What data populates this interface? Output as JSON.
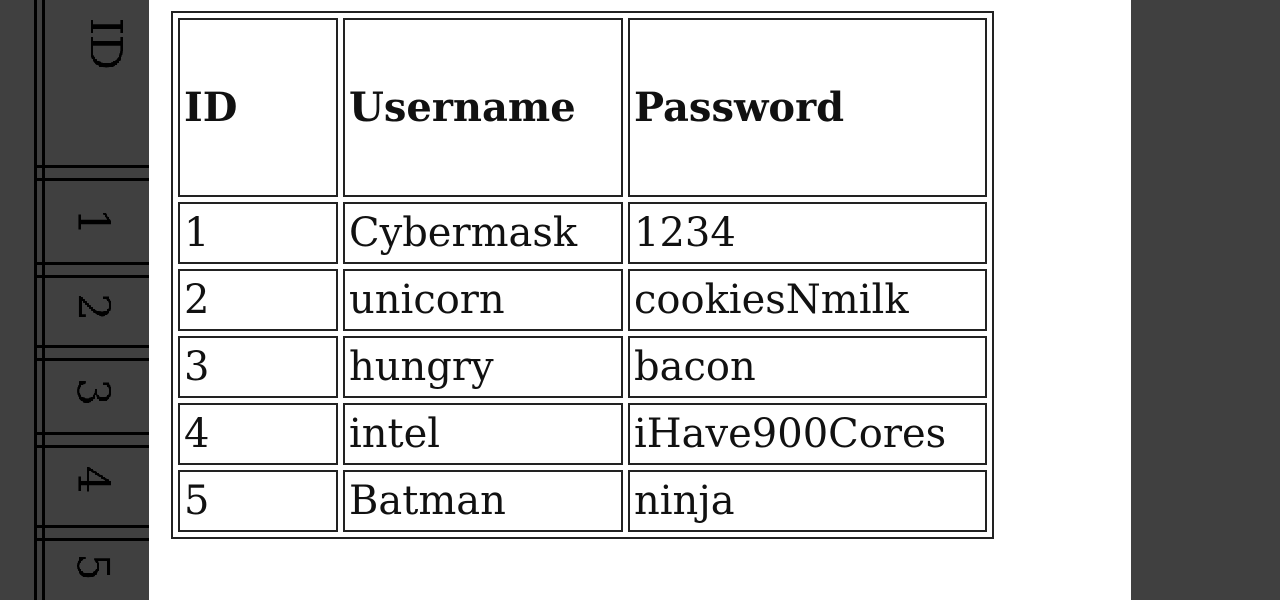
{
  "table": {
    "headers": [
      "ID",
      "Username",
      "Password"
    ],
    "rows": [
      [
        "1",
        "Cybermask",
        "1234"
      ],
      [
        "2",
        "unicorn",
        "cookiesNmilk"
      ],
      [
        "3",
        "hungry",
        "bacon"
      ],
      [
        "4",
        "intel",
        "iHave900Cores"
      ],
      [
        "5",
        "Batman",
        "ninja"
      ]
    ]
  },
  "background_strip_digits": [
    "ID",
    "1",
    "2",
    "3",
    "4",
    "5"
  ],
  "colors": {
    "background": "#ffffff",
    "border": "#222222",
    "text": "#111111"
  }
}
